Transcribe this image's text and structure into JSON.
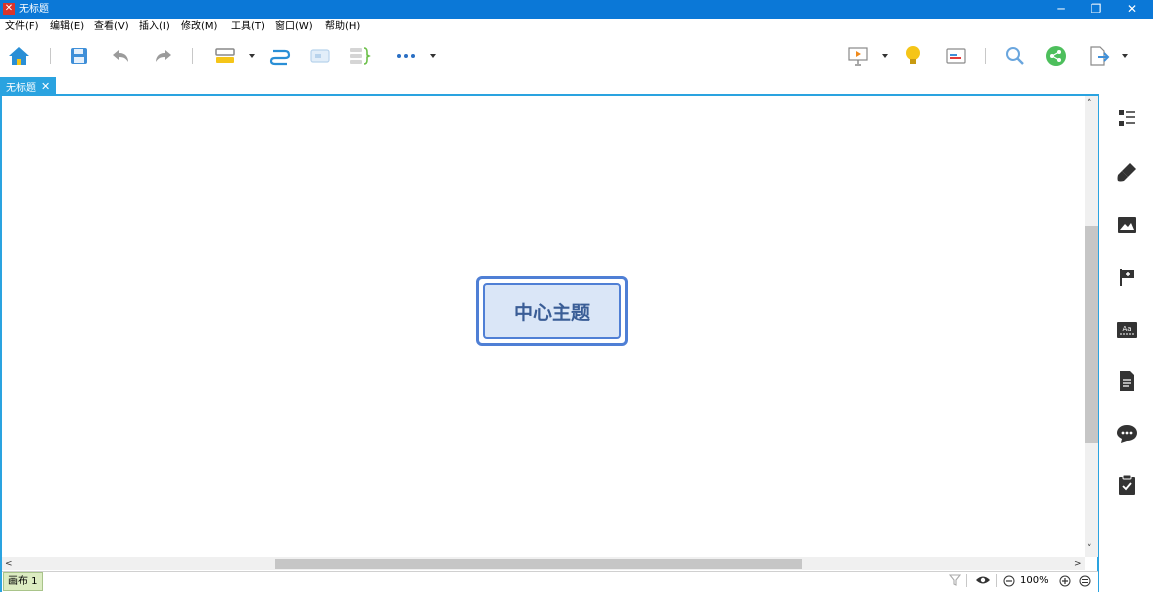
{
  "window": {
    "title": "无标题",
    "logo_icon": "xmind-logo-icon",
    "controls": [
      "minimize-icon",
      "restore-icon",
      "close-icon"
    ]
  },
  "menu": {
    "items": [
      "文件(F)",
      "编辑(E)",
      "查看(V)",
      "插入(I)",
      "修改(M)",
      "工具(T)",
      "窗口(W)",
      "帮助(H)"
    ]
  },
  "toolbar": {
    "left_icons": [
      "home-icon",
      "save-icon",
      "undo-icon",
      "redo-icon",
      "topic-icon",
      "relationship-icon",
      "boundary-icon",
      "summary-icon",
      "more-icon"
    ],
    "right_icons": [
      "presentation-icon",
      "brainstorm-icon",
      "gantt-icon",
      "search-icon",
      "share-icon",
      "export-icon"
    ]
  },
  "tab": {
    "label": "无标题",
    "close": "✕"
  },
  "canvas": {
    "central_topic": "中心主题"
  },
  "status": {
    "sheet_label": "画布 1",
    "zoom": "100%"
  },
  "right_panel": {
    "icons": [
      "outline-icon",
      "format-icon",
      "image-icon",
      "marker-icon",
      "text-label-icon",
      "notes-icon",
      "comment-icon",
      "task-icon"
    ]
  },
  "colors": {
    "titlebar": "#0b78d7",
    "tab_active": "#2aa3e0",
    "topic_border": "#4f7fd5",
    "topic_fill": "#dae6f7",
    "topic_text": "#3a5d96"
  }
}
